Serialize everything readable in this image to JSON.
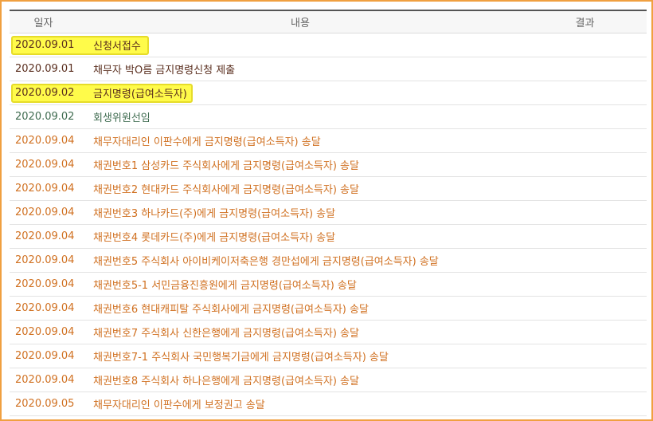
{
  "columns": {
    "date": "일자",
    "content": "내용",
    "result": "결과"
  },
  "rows": [
    {
      "date": "2020.09.01",
      "content": "신청서접수",
      "result": "",
      "tone": "dark",
      "highlight": "w1"
    },
    {
      "date": "2020.09.01",
      "content": "채무자 박O름 금지명령신청 제출",
      "result": "",
      "tone": "dark",
      "highlight": ""
    },
    {
      "date": "2020.09.02",
      "content": "금지명령(급여소득자)",
      "result": "",
      "tone": "dark",
      "highlight": "w2"
    },
    {
      "date": "2020.09.02",
      "content": "회생위원선임",
      "result": "",
      "tone": "green",
      "highlight": ""
    },
    {
      "date": "2020.09.04",
      "content": "채무자대리인 이판수에게 금지명령(급여소득자) 송달",
      "result": "",
      "tone": "orange",
      "highlight": ""
    },
    {
      "date": "2020.09.04",
      "content": "채권번호1 삼성카드 주식회사에게 금지명령(급여소득자) 송달",
      "result": "",
      "tone": "orange",
      "highlight": ""
    },
    {
      "date": "2020.09.04",
      "content": "채권번호2 현대카드 주식회사에게 금지명령(급여소득자) 송달",
      "result": "",
      "tone": "orange",
      "highlight": ""
    },
    {
      "date": "2020.09.04",
      "content": "채권번호3 하나카드(주)에게 금지명령(급여소득자) 송달",
      "result": "",
      "tone": "orange",
      "highlight": ""
    },
    {
      "date": "2020.09.04",
      "content": "채권번호4 롯데카드(주)에게 금지명령(급여소득자) 송달",
      "result": "",
      "tone": "orange",
      "highlight": ""
    },
    {
      "date": "2020.09.04",
      "content": "채권번호5 주식회사 아이비케이저축은행 경만섭에게 금지명령(급여소득자) 송달",
      "result": "",
      "tone": "orange",
      "highlight": ""
    },
    {
      "date": "2020.09.04",
      "content": "채권번호5-1 서민금융진흥원에게 금지명령(급여소득자) 송달",
      "result": "",
      "tone": "orange",
      "highlight": ""
    },
    {
      "date": "2020.09.04",
      "content": "채권번호6 현대캐피탈 주식회사에게 금지명령(급여소득자) 송달",
      "result": "",
      "tone": "orange",
      "highlight": ""
    },
    {
      "date": "2020.09.04",
      "content": "채권번호7 주식회사 신한은행에게 금지명령(급여소득자) 송달",
      "result": "",
      "tone": "orange",
      "highlight": ""
    },
    {
      "date": "2020.09.04",
      "content": "채권번호7-1 주식회사 국민행복기금에게 금지명령(급여소득자) 송달",
      "result": "",
      "tone": "orange",
      "highlight": ""
    },
    {
      "date": "2020.09.04",
      "content": "채권번호8 주식회사 하나은행에게 금지명령(급여소득자) 송달",
      "result": "",
      "tone": "orange",
      "highlight": ""
    },
    {
      "date": "2020.09.05",
      "content": "채무자대리인 이판수에게 보정권고 송달",
      "result": "",
      "tone": "orange",
      "highlight": ""
    }
  ],
  "colors": {
    "frame_border": "#f0a040",
    "highlight": "#fffb4a",
    "text_dark": "#5a2e1e",
    "text_green": "#3e6b4f",
    "text_orange": "#d07020"
  }
}
